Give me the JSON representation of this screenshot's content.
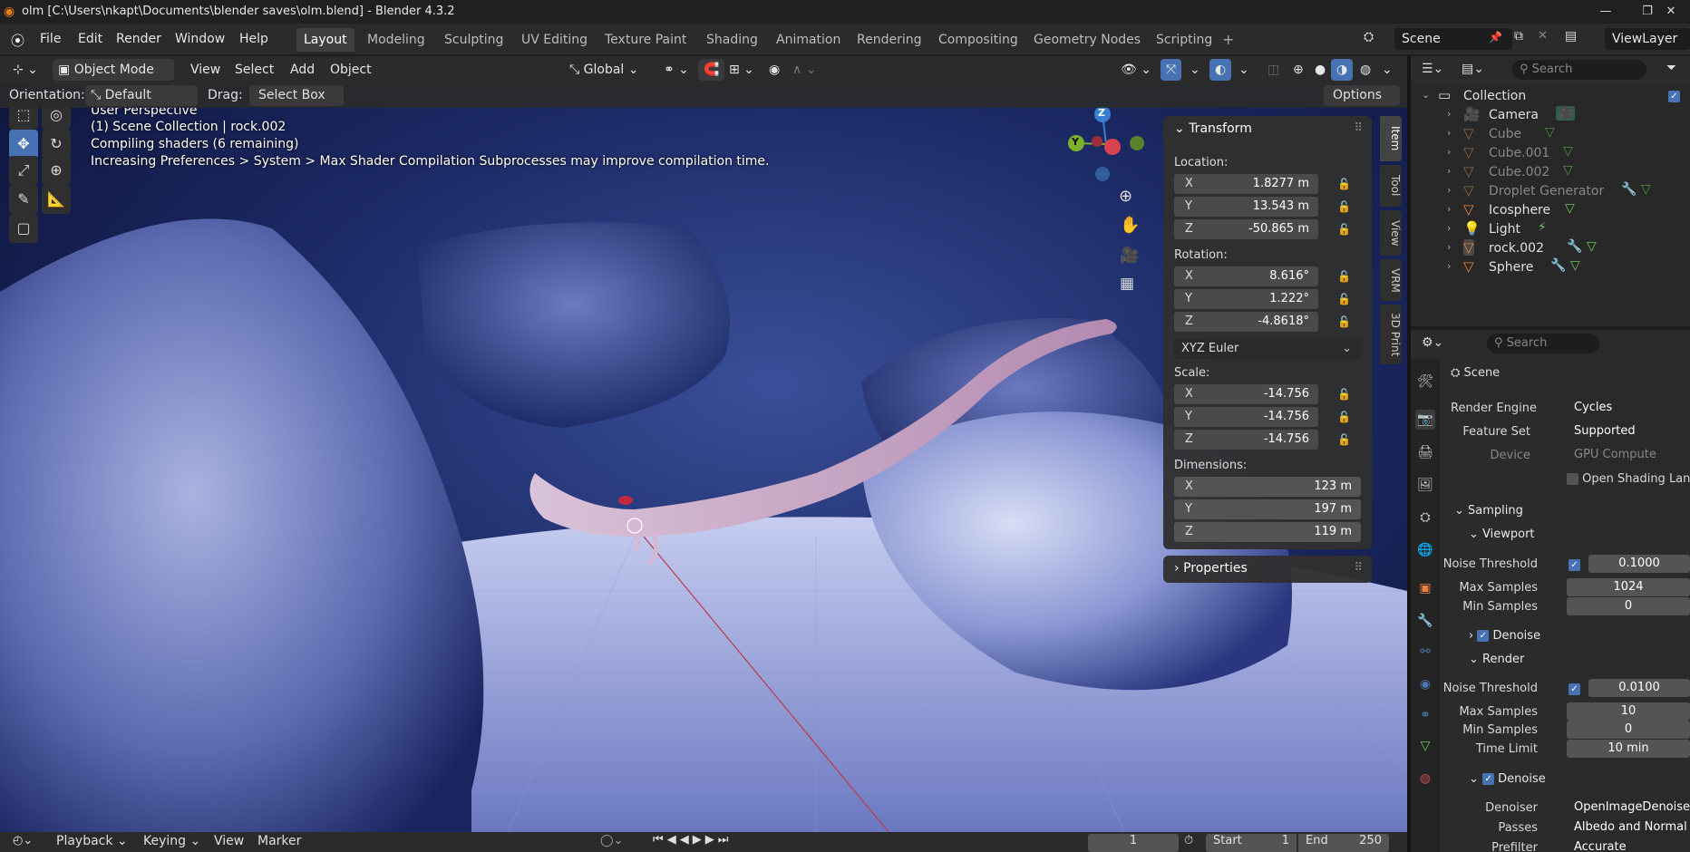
{
  "window": {
    "title": "olm [C:\\Users\\nkapt\\Documents\\blender saves\\olm.blend] - Blender 4.3.2",
    "controls": [
      "—",
      "❐",
      "✕"
    ]
  },
  "menu": [
    "File",
    "Edit",
    "Render",
    "Window",
    "Help"
  ],
  "workspaces": [
    "Layout",
    "Modeling",
    "Sculpting",
    "UV Editing",
    "Texture Paint",
    "Shading",
    "Animation",
    "Rendering",
    "Compositing",
    "Geometry Nodes",
    "Scripting"
  ],
  "scene": {
    "name": "Scene",
    "view_layer": "ViewLayer"
  },
  "viewport_header": {
    "mode": "Object Mode",
    "menus": [
      "View",
      "Select",
      "Add",
      "Object"
    ],
    "transform_orientation": "Global"
  },
  "tool_settings": {
    "orientation_label": "Orientation:",
    "orientation_value": "Default",
    "drag_label": "Drag:",
    "drag_value": "Select Box",
    "options": "Options"
  },
  "overlay": {
    "line1": "User Perspective",
    "line2": "(1) Scene Collection | rock.002",
    "line3": "Compiling shaders (6 remaining)",
    "line4": "Increasing Preferences > System > Max Shader Compilation Subprocesses may improve compilation time."
  },
  "gizmo": {
    "z": "Z",
    "y": "Y"
  },
  "npanel": {
    "header": "Transform",
    "location_label": "Location:",
    "location": [
      {
        "axis": "X",
        "value": "1.8277 m"
      },
      {
        "axis": "Y",
        "value": "13.543 m"
      },
      {
        "axis": "Z",
        "value": "-50.865 m"
      }
    ],
    "rotation_label": "Rotation:",
    "rotation": [
      {
        "axis": "X",
        "value": "8.616°"
      },
      {
        "axis": "Y",
        "value": "1.222°"
      },
      {
        "axis": "Z",
        "value": "-4.8618°"
      }
    ],
    "rotation_mode": "XYZ Euler",
    "scale_label": "Scale:",
    "scale": [
      {
        "axis": "X",
        "value": "-14.756"
      },
      {
        "axis": "Y",
        "value": "-14.756"
      },
      {
        "axis": "Z",
        "value": "-14.756"
      }
    ],
    "dimensions_label": "Dimensions:",
    "dimensions": [
      {
        "axis": "X",
        "value": "123 m"
      },
      {
        "axis": "Y",
        "value": "197 m"
      },
      {
        "axis": "Z",
        "value": "119 m"
      }
    ],
    "properties_header": "Properties",
    "tabs": [
      "Item",
      "Tool",
      "View",
      "VRM",
      "3D Print"
    ]
  },
  "outliner": {
    "search_placeholder": "Search",
    "collection": "Collection",
    "items": [
      "Camera",
      "Cube",
      "Cube.001",
      "Cube.002",
      "Droplet Generator",
      "Icosphere",
      "Light",
      "rock.002",
      "Sphere"
    ]
  },
  "properties": {
    "search_placeholder": "Search",
    "scene_label": "Scene",
    "render_engine_label": "Render Engine",
    "render_engine": "Cycles",
    "feature_set_label": "Feature Set",
    "feature_set": "Supported",
    "device_label": "Device",
    "device": "GPU Compute",
    "osl_label": "Open Shading Langua",
    "sampling": "Sampling",
    "viewport": "Viewport",
    "vp_noise_label": "Noise Threshold",
    "vp_noise": "0.1000",
    "vp_max_label": "Max Samples",
    "vp_max": "1024",
    "vp_min_label": "Min Samples",
    "vp_min": "0",
    "vp_denoise": "Denoise",
    "render": "Render",
    "r_noise_label": "Noise Threshold",
    "r_noise": "0.0100",
    "r_max_label": "Max Samples",
    "r_max": "10",
    "r_min_label": "Min Samples",
    "r_min": "0",
    "r_time_label": "Time Limit",
    "r_time": "10 min",
    "r_denoise": "Denoise",
    "denoiser_label": "Denoiser",
    "denoiser": "OpenImageDenoise",
    "passes_label": "Passes",
    "passes": "Albedo and Normal",
    "prefilter_label": "Prefilter",
    "prefilter": "Accurate"
  },
  "timeline": {
    "menus": [
      "Playback",
      "Keying",
      "View",
      "Marker"
    ],
    "current_frame": "1",
    "start_label": "Start",
    "start": "1",
    "end_label": "End",
    "end": "250"
  },
  "colors": {
    "accent": "#4772b3",
    "gizmo_x": "#d9434f",
    "gizmo_y": "#7ab22c",
    "gizmo_z": "#3b7fd0",
    "object_orange": "#e8813a",
    "mesh_green": "#6bc25a"
  }
}
